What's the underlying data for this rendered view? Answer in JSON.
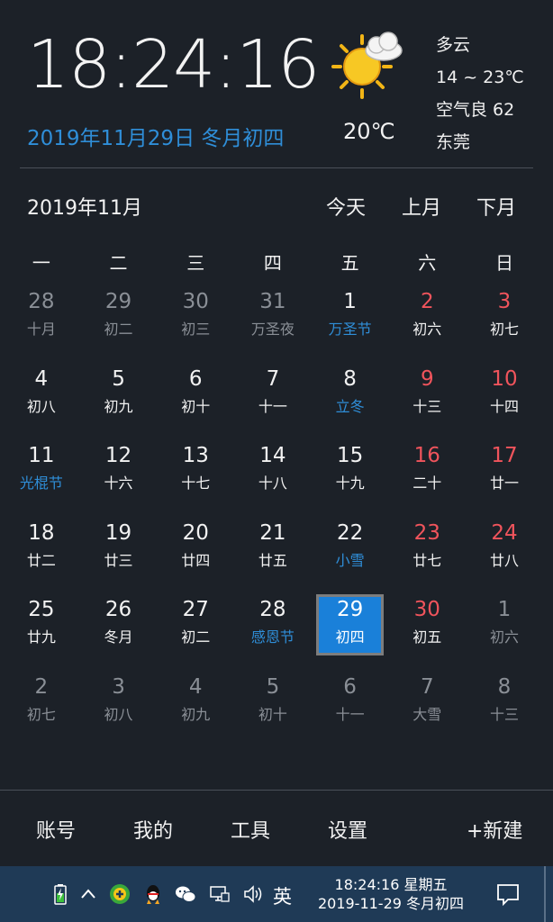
{
  "header": {
    "clock": "18:24:16",
    "date_line": "2019年11月29日 冬月初四",
    "temp_now": "20℃",
    "weather": {
      "condition": "多云",
      "range": "14 ~ 23℃",
      "air": "空气良 62",
      "city": "东莞"
    }
  },
  "calendar": {
    "month_title": "2019年11月",
    "today_btn": "今天",
    "prev_btn": "上月",
    "next_btn": "下月",
    "weekdays": [
      "一",
      "二",
      "三",
      "四",
      "五",
      "六",
      "日"
    ],
    "rows": [
      [
        {
          "d": "28",
          "l": "十月",
          "dim": true
        },
        {
          "d": "29",
          "l": "初二",
          "dim": true
        },
        {
          "d": "30",
          "l": "初三",
          "dim": true
        },
        {
          "d": "31",
          "l": "万圣夜",
          "dim": true
        },
        {
          "d": "1",
          "l": "万圣节",
          "fest": true
        },
        {
          "d": "2",
          "l": "初六",
          "we": true
        },
        {
          "d": "3",
          "l": "初七",
          "we": true
        }
      ],
      [
        {
          "d": "4",
          "l": "初八"
        },
        {
          "d": "5",
          "l": "初九"
        },
        {
          "d": "6",
          "l": "初十"
        },
        {
          "d": "7",
          "l": "十一"
        },
        {
          "d": "8",
          "l": "立冬",
          "fest": true
        },
        {
          "d": "9",
          "l": "十三",
          "we": true
        },
        {
          "d": "10",
          "l": "十四",
          "we": true
        }
      ],
      [
        {
          "d": "11",
          "l": "光棍节",
          "fest": true
        },
        {
          "d": "12",
          "l": "十六"
        },
        {
          "d": "13",
          "l": "十七"
        },
        {
          "d": "14",
          "l": "十八"
        },
        {
          "d": "15",
          "l": "十九"
        },
        {
          "d": "16",
          "l": "二十",
          "we": true
        },
        {
          "d": "17",
          "l": "廿一",
          "we": true
        }
      ],
      [
        {
          "d": "18",
          "l": "廿二"
        },
        {
          "d": "19",
          "l": "廿三"
        },
        {
          "d": "20",
          "l": "廿四"
        },
        {
          "d": "21",
          "l": "廿五"
        },
        {
          "d": "22",
          "l": "小雪",
          "fest": true
        },
        {
          "d": "23",
          "l": "廿七",
          "we": true
        },
        {
          "d": "24",
          "l": "廿八",
          "we": true
        }
      ],
      [
        {
          "d": "25",
          "l": "廿九"
        },
        {
          "d": "26",
          "l": "冬月"
        },
        {
          "d": "27",
          "l": "初二"
        },
        {
          "d": "28",
          "l": "感恩节",
          "fest": true
        },
        {
          "d": "29",
          "l": "初四",
          "today": true
        },
        {
          "d": "30",
          "l": "初五",
          "we": true
        },
        {
          "d": "1",
          "l": "初六",
          "dim": true
        }
      ],
      [
        {
          "d": "2",
          "l": "初七",
          "dim": true
        },
        {
          "d": "3",
          "l": "初八",
          "dim": true
        },
        {
          "d": "4",
          "l": "初九",
          "dim": true
        },
        {
          "d": "5",
          "l": "初十",
          "dim": true
        },
        {
          "d": "6",
          "l": "十一",
          "dim": true
        },
        {
          "d": "7",
          "l": "大雪",
          "dim": true
        },
        {
          "d": "8",
          "l": "十三",
          "dim": true
        }
      ]
    ]
  },
  "bottom_menu": {
    "account": "账号",
    "mine": "我的",
    "tools": "工具",
    "settings": "设置",
    "new": "+新建"
  },
  "taskbar": {
    "time_line": "18:24:16 星期五",
    "date_line": "2019-11-29 冬月初四",
    "ime": "英"
  },
  "colors": {
    "background": "#1c2128",
    "accent": "#2f8ed8",
    "weekend": "#f0545c",
    "today_fill": "#1a80d9",
    "taskbar": "#1f3a56"
  }
}
